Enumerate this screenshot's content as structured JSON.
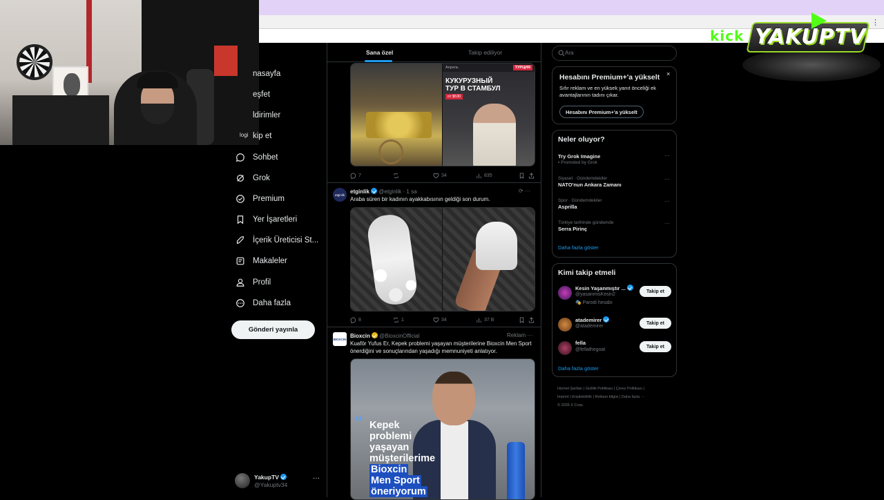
{
  "stream": {
    "kick_label": "kick",
    "brand": "YAKUPTV"
  },
  "nav": {
    "items": [
      {
        "label": "Anasayfa",
        "icon": "home-icon"
      },
      {
        "label": "Keşfet",
        "icon": "search-icon"
      },
      {
        "label": "Bildirimler",
        "icon": "bell-icon"
      },
      {
        "label": "Takip et",
        "icon": "person-add-icon"
      },
      {
        "label": "Sohbet",
        "icon": "chat-icon"
      },
      {
        "label": "Grok",
        "icon": "grok-icon"
      },
      {
        "label": "Premium",
        "icon": "premium-icon"
      },
      {
        "label": "Yer İşaretleri",
        "icon": "bookmark-icon"
      },
      {
        "label": "İçerik Üreticisi St...",
        "icon": "rocket-icon"
      },
      {
        "label": "Makaleler",
        "icon": "article-icon"
      },
      {
        "label": "Profil",
        "icon": "profile-icon"
      },
      {
        "label": "Daha fazla",
        "icon": "more-circle-icon"
      }
    ],
    "visible": [
      "nasayfa",
      "eşfet",
      "ldirimler",
      "kip et"
    ],
    "logo_overlay": "logi",
    "post_button": "Gönderi yayınla",
    "user": {
      "name": "YakupTV",
      "handle": "@Yakuptv34",
      "more": "···"
    }
  },
  "timeline": {
    "tabs": [
      {
        "label": "Sana özel",
        "active": true
      },
      {
        "label": "Takip ediliyor",
        "active": false
      }
    ],
    "tweet1": {
      "media": {
        "header": "Апрель",
        "badge": "ТУРЦИЯ",
        "title_line1": "КУКУРУЗНЫЙ",
        "title_line2": "ТУР В СТАМБУЛ",
        "price": "от $530"
      },
      "actions": {
        "replies": "7",
        "reposts": "",
        "likes": "34",
        "views": "835"
      }
    },
    "tweet2": {
      "avatar_text": "etginlik",
      "name": "etginlik",
      "handle": "@etginlik",
      "time": "· 1 sa",
      "text": "Araba süren bir kadının ayakkabısının geldiği son durum.",
      "actions": {
        "replies": "8",
        "reposts": "1",
        "likes": "34",
        "views": "37 B"
      }
    },
    "tweet3": {
      "avatar_text": "BIOXCIN",
      "name": "Bioxcin",
      "handle": "@BioxcinOfficial",
      "ad_label": "Reklam",
      "text": "Kuaför Yufus Er, Kepek problemi yaşayan müşterilerine Bioxcin Men Sport önerdiğini ve sonuçlarından yaşadığı memnuniyeti anlatıyor.",
      "media": {
        "line1": "Kepek",
        "line2": "problemi",
        "line3": "yaşayan",
        "line4": "müşterilerime",
        "line5": "Bioxcin",
        "line6": "Men Sport",
        "line7": "öneriyorum"
      }
    }
  },
  "sidebar": {
    "search_placeholder": "Ara",
    "premium": {
      "title": "Hesabını Premium+'a yükselt",
      "desc": "Sıfır reklam ve en yüksek yanıt önceliği ek avantajlarının tadını çıkar.",
      "button": "Hesabını Premium+'a yükselt",
      "close": "×"
    },
    "trends": {
      "title": "Neler oluyor?",
      "items": [
        {
          "context": "",
          "name": "Try Grok Imagine",
          "promo": "Promoted by Grok"
        },
        {
          "context": "Siyaset · Gündemdekiler",
          "name": "NATO'nun Ankara Zamanı",
          "promo": ""
        },
        {
          "context": "Spor · Gündemdekiler",
          "name": "Asprilla",
          "promo": ""
        },
        {
          "context": "Türkiye tarihinde gündemde",
          "name": "Serra Pirinç",
          "promo": ""
        }
      ],
      "show_more": "Daha fazla göster"
    },
    "who_to_follow": {
      "title": "Kimi takip etmeli",
      "users": [
        {
          "name": "Kesin Yaşanmıştır ...",
          "handle": "@yasanmisKesin2",
          "sub": "Parodi hesabı",
          "button": "Takip et"
        },
        {
          "name": "atademirer",
          "handle": "@atademirer",
          "sub": "",
          "button": "Takip et"
        },
        {
          "name": "fella",
          "handle": "@fellathegoat",
          "sub": "",
          "button": "Takip et"
        }
      ],
      "show_more": "Daha fazla göster"
    },
    "footer": {
      "line1": "Hizmet Şartları  |  Gizlilik Politikası  |  Çerez Politikası  |",
      "line2": "Imprint  |  Erişilebilirlik  |  Reklam bilgisi  |  Daha fazla ···",
      "line3": "© 2026 X Corp."
    }
  },
  "colors": {
    "accent": "#1d9bf0",
    "bg": "#000000",
    "border": "#2f3336",
    "muted": "#71767b",
    "kick_green": "#53fc18"
  }
}
